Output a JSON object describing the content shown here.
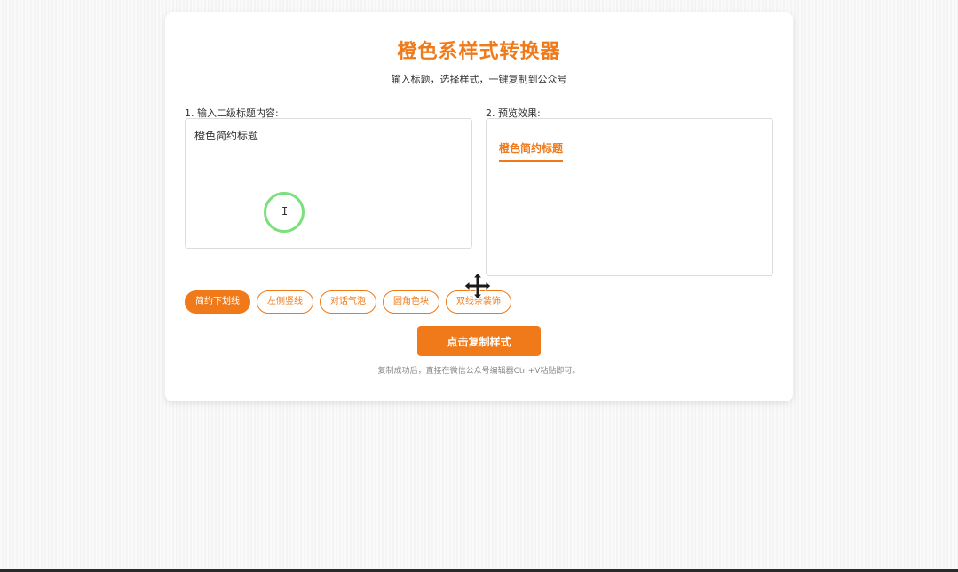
{
  "app": {
    "title": "橙色系样式转换器",
    "subtitle": "输入标题，选择样式，一键复制到公众号"
  },
  "input_section": {
    "label": "1. 输入二级标题内容:",
    "value": "橙色简约标题"
  },
  "preview_section": {
    "label": "2. 预览效果:",
    "heading": "橙色简约标题"
  },
  "styles": {
    "options": [
      "简约下划线",
      "左侧竖线",
      "对话气泡",
      "圆角色块",
      "双线条装饰"
    ],
    "selected": "简约下划线"
  },
  "actions": {
    "copy_label": "点击复制样式",
    "hint": "复制成功后，直接在微信公众号编辑器Ctrl+V粘贴即可。"
  },
  "colors": {
    "accent": "#f07a1a",
    "click_ring": "#7be07b"
  },
  "cursor": {
    "text_cursor": "I-beam",
    "move_cursor": "move-icon"
  }
}
